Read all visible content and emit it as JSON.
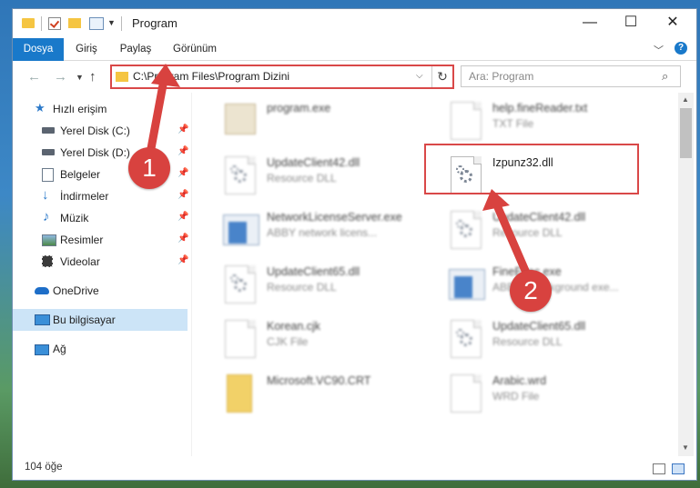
{
  "window": {
    "title": "Program",
    "minimize_icon": "minimize-icon",
    "maximize_icon": "maximize-icon",
    "close_icon": "close-icon"
  },
  "quick_access_toolbar": {
    "icons": [
      "folder-icon",
      "properties-check-icon",
      "new-folder-icon",
      "properties-icon",
      "customize-dropdown-icon"
    ]
  },
  "ribbon": {
    "tabs": [
      "Dosya",
      "Giriş",
      "Paylaş",
      "Görünüm"
    ],
    "active": "Dosya",
    "colors": {
      "file_tab": "#1979ca"
    }
  },
  "navigation": {
    "address": "C:\\Program Files\\Program Dizini",
    "search_placeholder": "Ara: Program"
  },
  "sidebar": {
    "items": [
      {
        "label": "Hızlı erişim",
        "icon": "star-icon",
        "pinned": false
      },
      {
        "label": "Yerel Disk (C:)",
        "icon": "drive-icon",
        "pinned": true
      },
      {
        "label": "Yerel Disk (D:)",
        "icon": "drive-icon",
        "pinned": true
      },
      {
        "label": "Belgeler",
        "icon": "documents-icon",
        "pinned": true
      },
      {
        "label": "İndirmeler",
        "icon": "download-icon",
        "pinned": true
      },
      {
        "label": "Müzik",
        "icon": "music-icon",
        "pinned": true
      },
      {
        "label": "Resimler",
        "icon": "pictures-icon",
        "pinned": true
      },
      {
        "label": "Videolar",
        "icon": "videos-icon",
        "pinned": true
      },
      {
        "label": "OneDrive",
        "icon": "cloud-icon",
        "pinned": false
      },
      {
        "label": "Bu bilgisayar",
        "icon": "computer-icon",
        "pinned": false,
        "selected": true
      },
      {
        "label": "Ağ",
        "icon": "network-icon",
        "pinned": false
      }
    ]
  },
  "files": [
    {
      "name": "program.exe",
      "type": "",
      "icon": "exe-icon"
    },
    {
      "name": "help.fineReader.txt",
      "type": "TXT File",
      "icon": "text-file-icon"
    },
    {
      "name": "UpdateClient42.dll",
      "type": "Resource DLL",
      "icon": "dll-icon"
    },
    {
      "name": "Izpunz32.dll",
      "type": "",
      "icon": "dll-icon",
      "highlighted": true
    },
    {
      "name": "NetworkLicenseServer.exe",
      "type": "ABBY network licens...",
      "icon": "app-icon"
    },
    {
      "name": "UpdateClient42.dll",
      "type": "Resource DLL",
      "icon": "dll-icon"
    },
    {
      "name": "UpdateClient65.dll",
      "type": "Resource DLL",
      "icon": "dll-icon"
    },
    {
      "name": "FineExec.exe",
      "type": "ABBYY background exe...",
      "icon": "app-icon"
    },
    {
      "name": "Korean.cjk",
      "type": "CJK File",
      "icon": "file-icon"
    },
    {
      "name": "UpdateClient65.dll",
      "type": "Resource DLL",
      "icon": "dll-icon"
    },
    {
      "name": "Microsoft.VC90.CRT",
      "type": "",
      "icon": "folder-icon"
    },
    {
      "name": "Arabic.wrd",
      "type": "WRD File",
      "icon": "file-icon"
    }
  ],
  "status": {
    "item_count": "104 öğe"
  },
  "annotations": [
    {
      "label": "1"
    },
    {
      "label": "2"
    }
  ],
  "colors": {
    "highlight_border": "#d94848",
    "badge": "#d8423f",
    "selected_item": "#cce4f7"
  }
}
